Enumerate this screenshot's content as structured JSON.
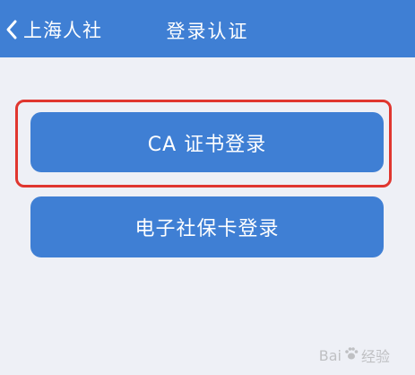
{
  "header": {
    "back_label": "上海人社",
    "title": "登录认证"
  },
  "buttons": {
    "ca_login": "CA 证书登录",
    "card_login": "电子社保卡登录"
  },
  "watermark": {
    "text_left": "Bai",
    "text_right": "经验"
  },
  "colors": {
    "nav_bg": "#3f7fd4",
    "button_bg": "#3f7fd4",
    "highlight": "#e0362f",
    "content_bg": "#eef0f6"
  },
  "icons": {
    "back": "chevron-left-icon",
    "watermark_logo": "paw-icon"
  }
}
